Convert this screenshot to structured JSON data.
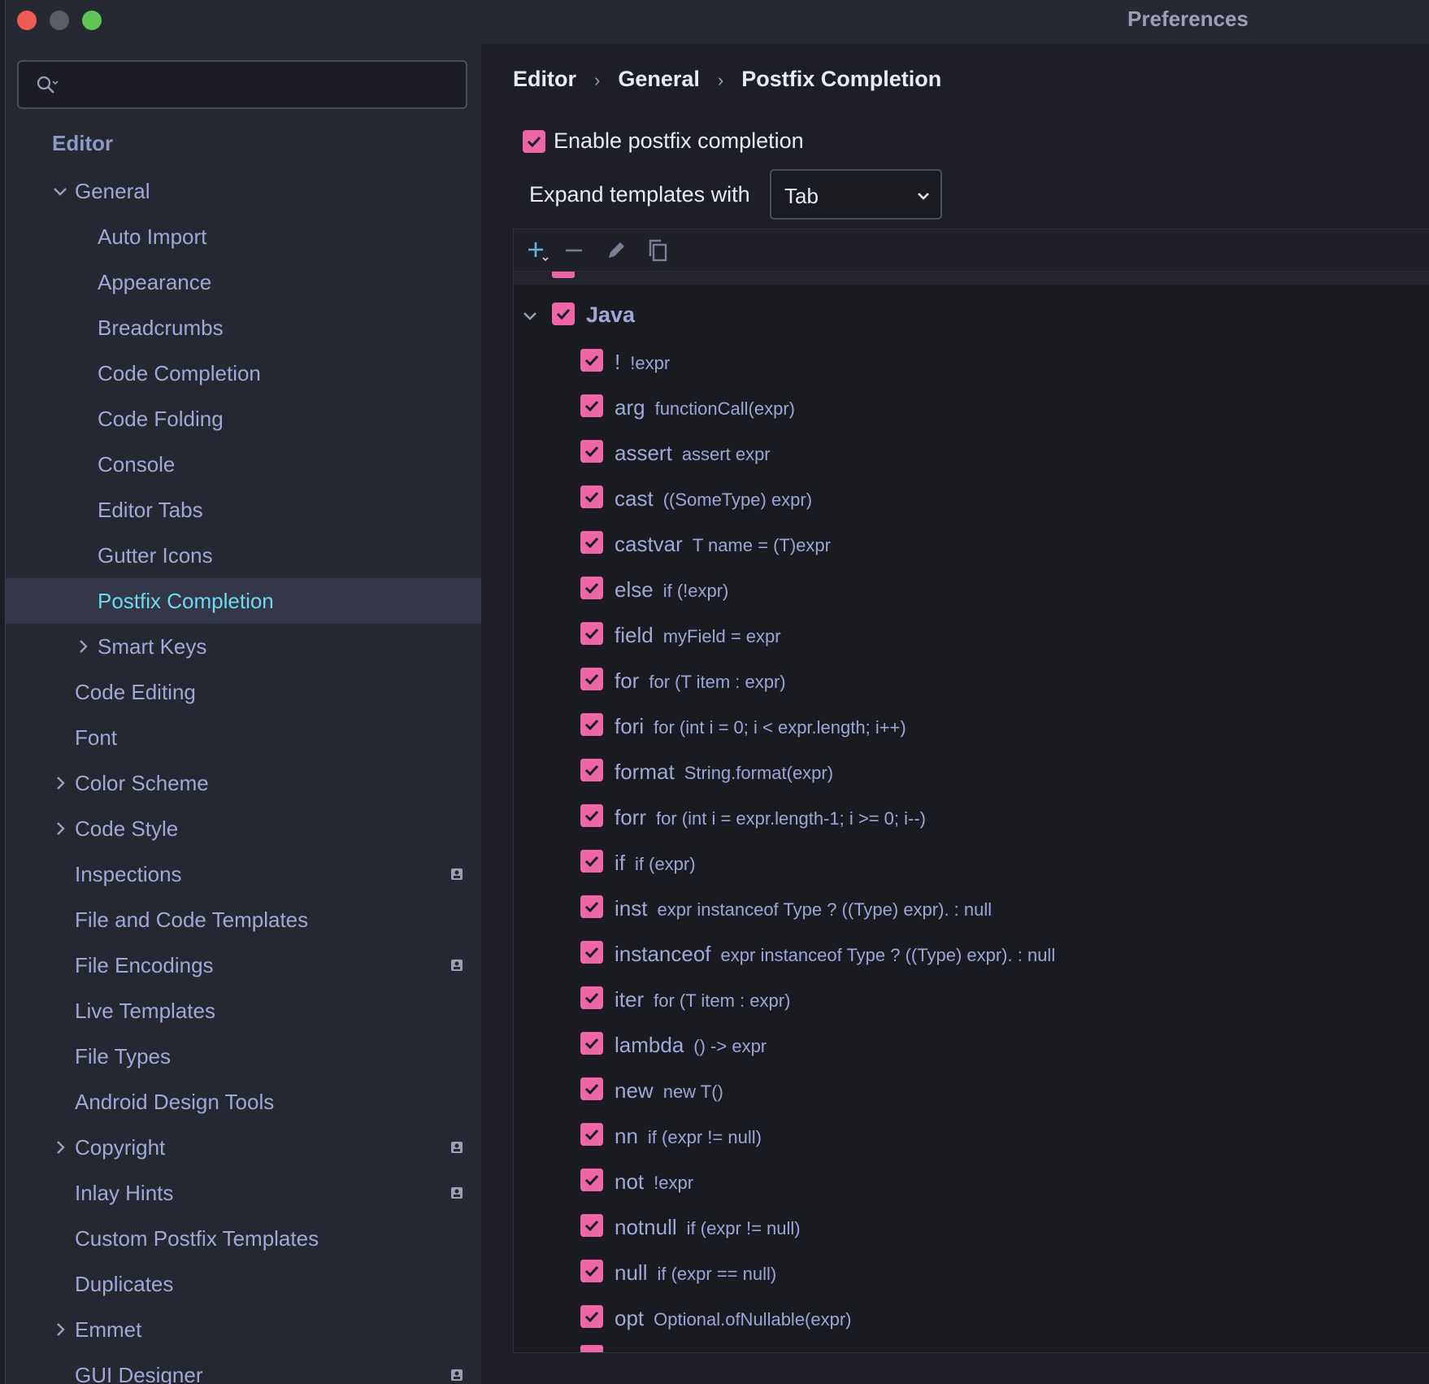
{
  "window": {
    "title": "Preferences"
  },
  "search": {
    "value": "",
    "placeholder": ""
  },
  "sidebar": {
    "items": [
      {
        "label": "Editor",
        "level": 0,
        "kind": "root"
      },
      {
        "label": "General",
        "level": 1,
        "arrow": "down"
      },
      {
        "label": "Auto Import",
        "level": 2
      },
      {
        "label": "Appearance",
        "level": 2
      },
      {
        "label": "Breadcrumbs",
        "level": 2
      },
      {
        "label": "Code Completion",
        "level": 2
      },
      {
        "label": "Code Folding",
        "level": 2
      },
      {
        "label": "Console",
        "level": 2
      },
      {
        "label": "Editor Tabs",
        "level": 2
      },
      {
        "label": "Gutter Icons",
        "level": 2
      },
      {
        "label": "Postfix Completion",
        "level": 2,
        "selected": true
      },
      {
        "label": "Smart Keys",
        "level": 2,
        "arrow": "right"
      },
      {
        "label": "Code Editing",
        "level": 1
      },
      {
        "label": "Font",
        "level": 1
      },
      {
        "label": "Color Scheme",
        "level": 1,
        "arrow": "right"
      },
      {
        "label": "Code Style",
        "level": 1,
        "arrow": "right"
      },
      {
        "label": "Inspections",
        "level": 1,
        "badge": true
      },
      {
        "label": "File and Code Templates",
        "level": 1
      },
      {
        "label": "File Encodings",
        "level": 1,
        "badge": true
      },
      {
        "label": "Live Templates",
        "level": 1
      },
      {
        "label": "File Types",
        "level": 1
      },
      {
        "label": "Android Design Tools",
        "level": 1
      },
      {
        "label": "Copyright",
        "level": 1,
        "arrow": "right",
        "badge": true
      },
      {
        "label": "Inlay Hints",
        "level": 1,
        "badge": true
      },
      {
        "label": "Custom Postfix Templates",
        "level": 1
      },
      {
        "label": "Duplicates",
        "level": 1
      },
      {
        "label": "Emmet",
        "level": 1,
        "arrow": "right"
      },
      {
        "label": "GUI Designer",
        "level": 1,
        "badge": true
      }
    ]
  },
  "breadcrumb": [
    "Editor",
    "General",
    "Postfix Completion"
  ],
  "enable": {
    "label": "Enable postfix completion",
    "checked": true
  },
  "expand": {
    "label": "Expand templates with",
    "selected": "Tab"
  },
  "toolbar": {
    "icons": [
      "add-icon",
      "remove-icon",
      "edit-icon",
      "copy-icon"
    ]
  },
  "group": {
    "label": "Java",
    "checked": true
  },
  "templates": [
    {
      "key": "!",
      "desc": "!expr"
    },
    {
      "key": "arg",
      "desc": "functionCall(expr)"
    },
    {
      "key": "assert",
      "desc": "assert expr"
    },
    {
      "key": "cast",
      "desc": "((SomeType) expr)"
    },
    {
      "key": "castvar",
      "desc": "T name = (T)expr"
    },
    {
      "key": "else",
      "desc": "if (!expr)"
    },
    {
      "key": "field",
      "desc": "myField = expr"
    },
    {
      "key": "for",
      "desc": "for (T item : expr)"
    },
    {
      "key": "fori",
      "desc": "for (int i = 0; i < expr.length; i++)"
    },
    {
      "key": "format",
      "desc": "String.format(expr)"
    },
    {
      "key": "forr",
      "desc": "for (int i = expr.length-1; i >= 0; i--)"
    },
    {
      "key": "if",
      "desc": "if (expr)"
    },
    {
      "key": "inst",
      "desc": "expr instanceof Type ? ((Type) expr). : null"
    },
    {
      "key": "instanceof",
      "desc": "expr instanceof Type ? ((Type) expr). : null"
    },
    {
      "key": "iter",
      "desc": "for (T item : expr)"
    },
    {
      "key": "lambda",
      "desc": "() -> expr"
    },
    {
      "key": "new",
      "desc": "new T()"
    },
    {
      "key": "nn",
      "desc": "if (expr != null)"
    },
    {
      "key": "not",
      "desc": "!expr"
    },
    {
      "key": "notnull",
      "desc": "if (expr != null)"
    },
    {
      "key": "null",
      "desc": "if (expr == null)"
    },
    {
      "key": "opt",
      "desc": "Optional.ofNullable(expr)"
    }
  ],
  "colors": {
    "accent_checkbox": "#ee66a6",
    "selected_text": "#6fd8f2",
    "tree_text": "#9fa9d8"
  }
}
